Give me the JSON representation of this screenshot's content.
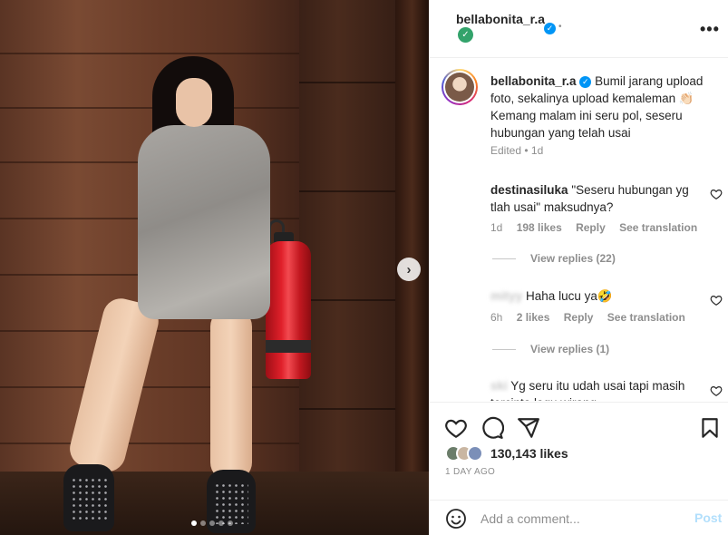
{
  "post": {
    "username": "bellabonita_r.a",
    "header_separator": "•",
    "caption_username": "bellabonita_r.a",
    "caption_text": "Bumil jarang upload foto, sekalinya upload kemaleman 👏🏻 Kemang malam ini seru pol, seseru hubungan yang telah usai",
    "caption_meta": "Edited • 1d",
    "likes": "130,143 likes",
    "time_ago": "1 DAY AGO",
    "carousel": {
      "total_slides": 5,
      "active_slide": 1
    }
  },
  "comments": [
    {
      "username": "destinasiluka",
      "text": "\"Seseru hubungan yg tlah usai\" maksudnya?",
      "time": "1d",
      "likes": "198 likes",
      "reply": "Reply",
      "translate": "See translation",
      "view_replies": "View replies (22)"
    },
    {
      "username": "mityy",
      "text": "Haha lucu ya🤣",
      "time": "6h",
      "likes": "2 likes",
      "reply": "Reply",
      "translate": "See translation",
      "view_replies": "View replies (1)"
    },
    {
      "username": "ski",
      "text": "Yg seru itu udah usai tapi masih tercinta lagu wirang"
    }
  ],
  "add_comment": {
    "placeholder": "Add a comment...",
    "post_label": "Post"
  },
  "icons": {
    "verified": "✓",
    "green_badge": "✓",
    "more": "•••",
    "next": "›"
  },
  "colors": {
    "verified_blue": "#0095f6",
    "post_disabled": "#b2dffc",
    "badge_green": "#33a36b"
  }
}
